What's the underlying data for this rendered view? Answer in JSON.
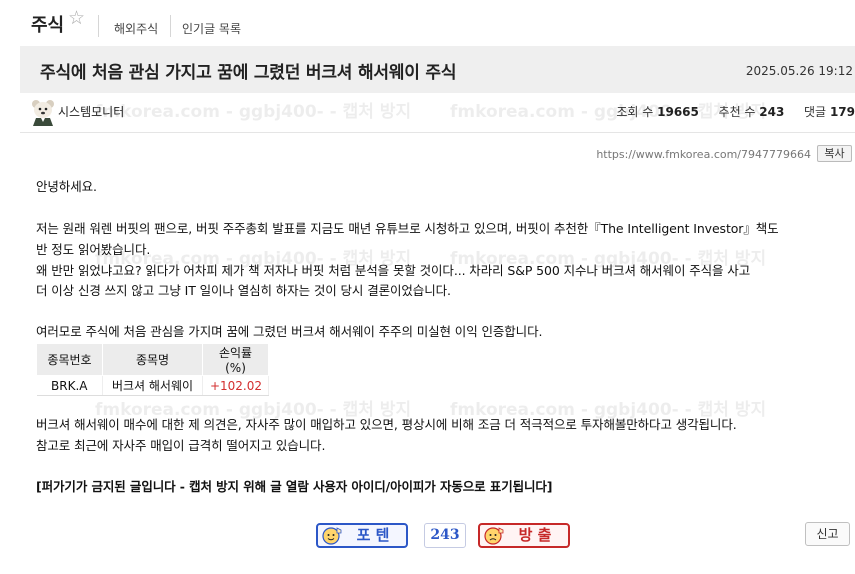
{
  "board": {
    "title": "주식",
    "links": [
      "해외주식",
      "인기글 목록"
    ]
  },
  "post": {
    "title": "주식에 처음 관심 가지고 꿈에 그렸던 버크셔 해서웨이 주식",
    "date": "2025.05.26 19:12",
    "author": "시스템모니터",
    "stats": {
      "views_label": "조회 수",
      "views": "19665",
      "recommend_label": "추천 수",
      "recommend": "243",
      "comments_label": "댓글",
      "comments": "179"
    },
    "url": "https://www.fmkorea.com/7947779664",
    "copy_label": "복사",
    "paragraphs": [
      "안녕하세요.",
      "저는 원래 워렌 버핏의 팬으로, 버핏 주주총회 발표를 지금도 매년 유튜브로 시청하고 있으며, 버핏이 추천한『The Intelligent Investor』책도",
      "반 정도 읽어봤습니다.",
      "왜 반만 읽었냐고요? 읽다가 어차피 제가 책 저자나 버핏 처럼 분석을 못할 것이다... 차라리 S&P 500 지수나 버크셔 해서웨이 주식을 사고",
      "더 이상 신경 쓰지 않고 그냥 IT 일이나 열심히 하자는 것이 당시 결론이었습니다.",
      "여러모로 주식에 처음 관심을 가지며 꿈에 그렸던 버크셔 해서웨이 주주의 미실현 이익 인증합니다.",
      "버크셔 해서웨이 매수에 대한 제 의견은, 자사주 많이 매입하고 있으면, 평상시에 비해 조금 더 적극적으로 투자해볼만하다고 생각됩니다.",
      "참고로 최근에 자사주 매입이 급격히 떨어지고 있습니다.",
      "[퍼가기가 금지된 글입니다 - 캡처 방지 위해 글 열람 사용자 아이디/아이피가 자동으로 표기됩니다]"
    ],
    "table": {
      "headers": [
        "종목번호",
        "종목명",
        "손익률(%)"
      ],
      "rows": [
        [
          "BRK.A",
          "버크셔 해서웨이",
          "+102.02"
        ]
      ]
    }
  },
  "watermark_text": "fmkorea.com - ggbj400- - 캡처 방지",
  "votes": {
    "up_label": "포 텐",
    "count": "243",
    "down_label": "방 출",
    "report_label": "신고"
  },
  "colors": {
    "up": "#2c57c7",
    "down": "#c62828",
    "profit": "#d32f2f"
  }
}
